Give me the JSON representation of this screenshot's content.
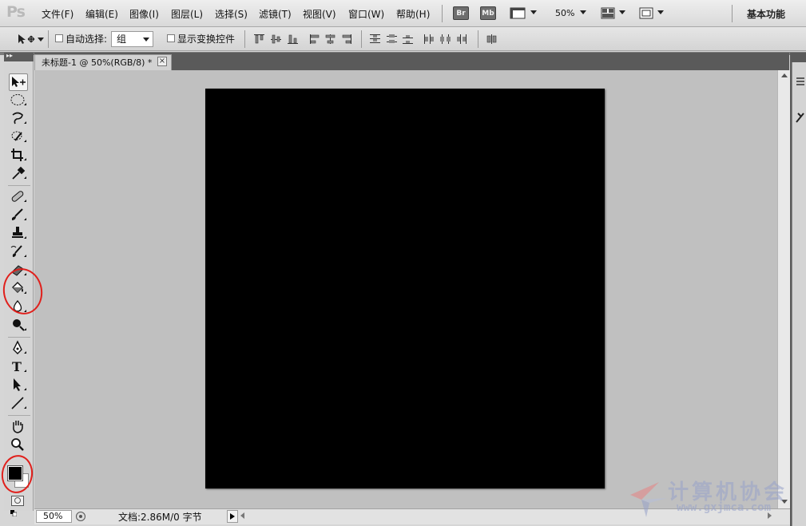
{
  "app": {
    "logo_text": "Ps"
  },
  "menubar": {
    "items": [
      {
        "label": "文件(F)"
      },
      {
        "label": "编辑(E)"
      },
      {
        "label": "图像(I)"
      },
      {
        "label": "图层(L)"
      },
      {
        "label": "选择(S)"
      },
      {
        "label": "滤镜(T)"
      },
      {
        "label": "视图(V)"
      },
      {
        "label": "窗口(W)"
      },
      {
        "label": "帮助(H)"
      }
    ],
    "bridge_label": "Br",
    "minibridge_label": "Mb",
    "zoom": "50%",
    "workspace": "基本功能"
  },
  "options": {
    "auto_select_label": "自动选择:",
    "auto_select_value": "组",
    "show_transform_label": "显示变换控件"
  },
  "document": {
    "tab_title": "未标题-1 @ 50%(RGB/8) *",
    "close_glyph": "×",
    "fill_color": "#000000"
  },
  "tools": {
    "foreground_color": "#000000",
    "background_color": "#ffffff"
  },
  "statusbar": {
    "zoom": "50%",
    "doc_info": "文档:2.86M/0 字节"
  },
  "watermark": {
    "text": "计算机协会",
    "url": "www.gxjmca.com"
  },
  "annotations": {
    "circle_color": "#e0201c"
  }
}
